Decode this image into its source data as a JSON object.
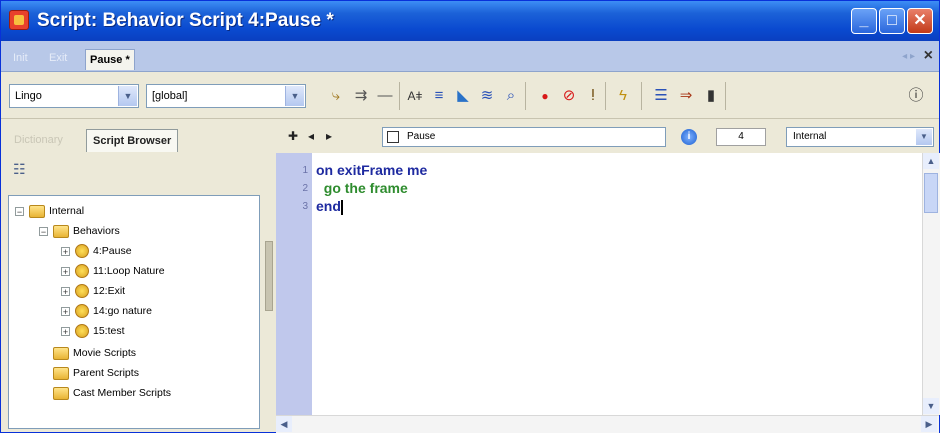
{
  "window": {
    "title": "Script: Behavior Script 4:Pause *"
  },
  "doc_tabs": [
    {
      "label": "Init",
      "active": false
    },
    {
      "label": "Exit",
      "active": false
    },
    {
      "label": "Pause *",
      "active": true
    }
  ],
  "toolbar": {
    "language": "Lingo",
    "scope": "[global]"
  },
  "left_panel": {
    "tabs": [
      {
        "label": "Dictionary",
        "active": false
      },
      {
        "label": "Script Browser",
        "active": true
      }
    ],
    "tree": {
      "internal": "Internal",
      "behaviors": "Behaviors",
      "behavior_items": [
        "4:Pause",
        "11:Loop Nature",
        "12:Exit",
        "14:go nature",
        "15:test"
      ],
      "movie_scripts": "Movie Scripts",
      "parent_scripts": "Parent Scripts",
      "cast_member_scripts": "Cast Member Scripts"
    }
  },
  "editor": {
    "handler": "Pause",
    "member_number": "4",
    "cast": "Internal",
    "lines": [
      {
        "num": "1",
        "text": "on exitFrame me"
      },
      {
        "num": "2",
        "text": "  go the frame"
      },
      {
        "num": "3",
        "text": "end"
      }
    ]
  }
}
